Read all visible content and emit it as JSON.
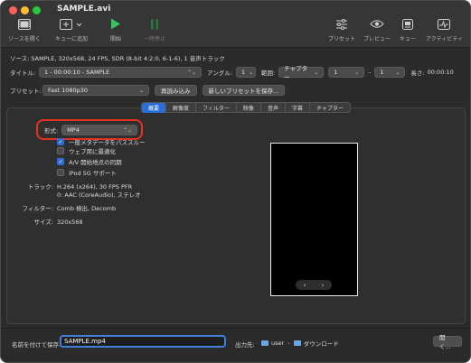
{
  "window": {
    "title": "SAMPLE.avi"
  },
  "toolbar": {
    "open_source": "ソースを開く",
    "add_to_queue": "キューに追加",
    "start": "開始",
    "pause": "一時停止",
    "presets": "プリセット",
    "preview": "プレビュー",
    "queue": "キュー",
    "activity": "アクティビティ"
  },
  "source": {
    "text": "ソース: SAMPLE, 320x568, 24 FPS, SDR (8-bit 4:2:0, 6-1-6), 1 音声トラック"
  },
  "title_row": {
    "title_label": "タイトル:",
    "title_value": "1 - 00:00:10 - SAMPLE",
    "angle_label": "アングル:",
    "angle_value": "1",
    "range_label": "範囲:",
    "range_type": "チャプター",
    "range_start": "1",
    "range_dash": "–",
    "range_end": "1",
    "duration_label": "長さ:",
    "duration_value": "00:00:10"
  },
  "preset_row": {
    "label": "プリセット:",
    "value": "Fast 1080p30",
    "reload": "再読み込み",
    "new_preset": "新しいプリセットを保存..."
  },
  "tabs": [
    "概要",
    "解像度",
    "フィルター",
    "映像",
    "音声",
    "字幕",
    "チャプター"
  ],
  "summary": {
    "format_label": "形式:",
    "format_value": "MP4",
    "options": [
      {
        "label": "一般メタデータをパススルー",
        "checked": true
      },
      {
        "label": "ウェブ用に最適化",
        "checked": false
      },
      {
        "label": "A/V 開始地点の同期",
        "checked": true
      },
      {
        "label": "iPod 5G サポート",
        "checked": false
      }
    ],
    "tracks_label": "トラック:",
    "tracks_line1": "H.264 (x264), 30 FPS PFR",
    "tracks_line2": "0: AAC (CoreAudio), ステレオ",
    "filters_label": "フィルター:",
    "filters_value": "Comb 検出, Decomb",
    "size_label": "サイズ:",
    "size_value": "320x568"
  },
  "preview_nav": {
    "prev": "‹",
    "next": "›"
  },
  "bottom": {
    "save_as_label": "名前を付けて保存:",
    "filename": "SAMPLE.mp4",
    "dest_label": "出力先:",
    "path_user": "user",
    "path_sep": "›",
    "path_folder": "ダウンロード",
    "browse": "開く..."
  }
}
